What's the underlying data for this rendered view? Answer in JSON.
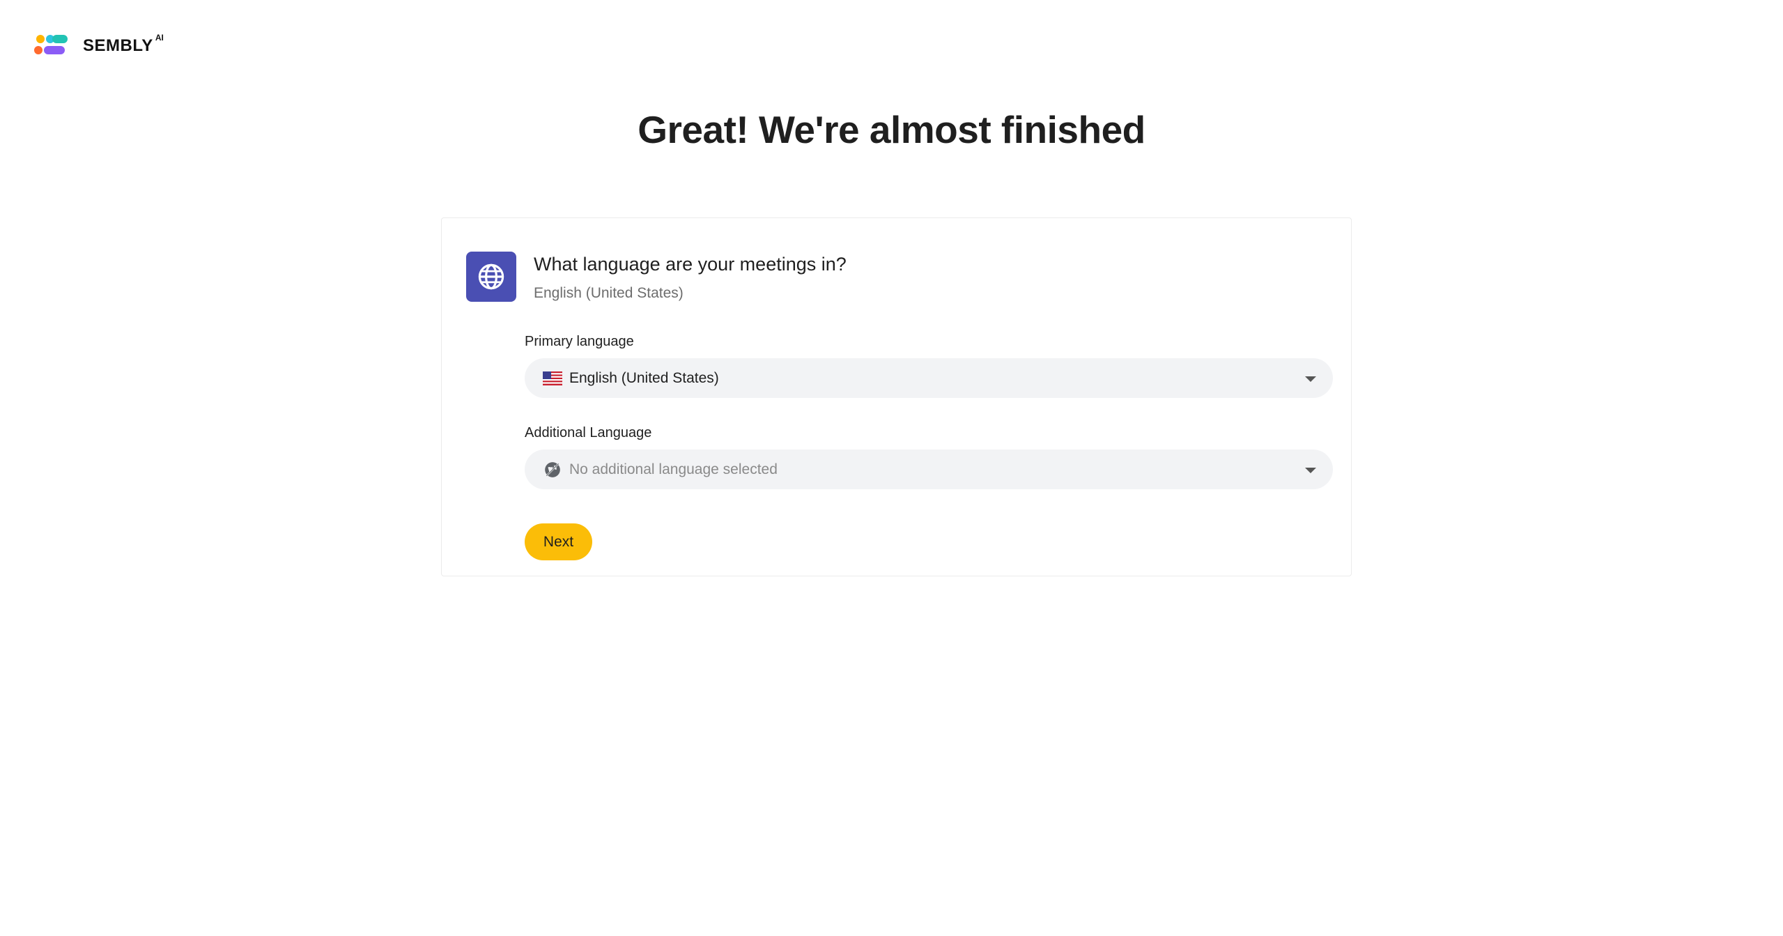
{
  "brand": {
    "name": "SEMBLY",
    "superscript": "AI",
    "logo_icon": "sembly-logo-dots",
    "logo_colors": [
      "#ffb400",
      "#2ec4e0",
      "#ff6a2e",
      "#8b5cf6",
      "#22c3b4"
    ]
  },
  "heading": "Great! We're almost finished",
  "card": {
    "icon": "globe-icon",
    "icon_bg": "#4a4fb3",
    "title": "What language are your meetings in?",
    "subtitle": "English (United States)",
    "primary": {
      "label": "Primary language",
      "icon": "us-flag-icon",
      "value": "English (United States)"
    },
    "additional": {
      "label": "Additional Language",
      "icon": "no-language-icon",
      "placeholder": "No additional language selected"
    },
    "next_label": "Next",
    "next_color": "#fbbd08"
  }
}
